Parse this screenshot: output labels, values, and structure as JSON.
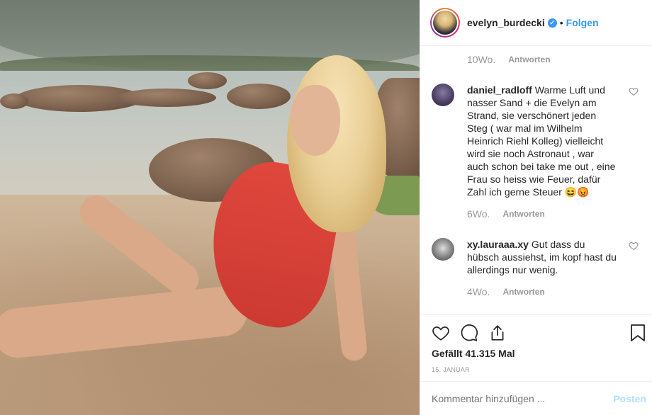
{
  "header": {
    "username": "evelyn_burdecki",
    "verified_glyph": "✔",
    "separator": "•",
    "follow_label": "Folgen"
  },
  "comments": [
    {
      "time": "10Wo.",
      "reply_label": "Antworten"
    },
    {
      "user": "daniel_radloff",
      "text": "Warme Luft und nasser Sand + die Evelyn am Strand, sie verschönert jeden Steg ( war mal im Wilhelm Heinrich Riehl Kolleg) vielleicht wird sie noch Astronaut , war auch schon bei take me out , eine Frau so heiss wie Feuer, dafür Zahl ich gerne Steuer 😆😡",
      "time": "6Wo.",
      "reply_label": "Antworten"
    },
    {
      "user": "xy.lauraaa.xy",
      "text": "Gut dass du hübsch aussiehst, im kopf hast du allerdings nur wenig.",
      "time": "4Wo.",
      "reply_label": "Antworten"
    }
  ],
  "actions": {
    "likes": "Gefällt 41.315 Mal",
    "date": "15. JANUAR"
  },
  "comment_box": {
    "placeholder": "Kommentar hinzufügen ...",
    "post_label": "Posten"
  },
  "icons": [
    "heart-icon",
    "comment-icon",
    "share-icon",
    "bookmark-icon",
    "verified-icon"
  ],
  "colors": {
    "accent": "#3897f0",
    "post_disabled": "#b2dffc",
    "swimsuit": "#d8413a"
  }
}
